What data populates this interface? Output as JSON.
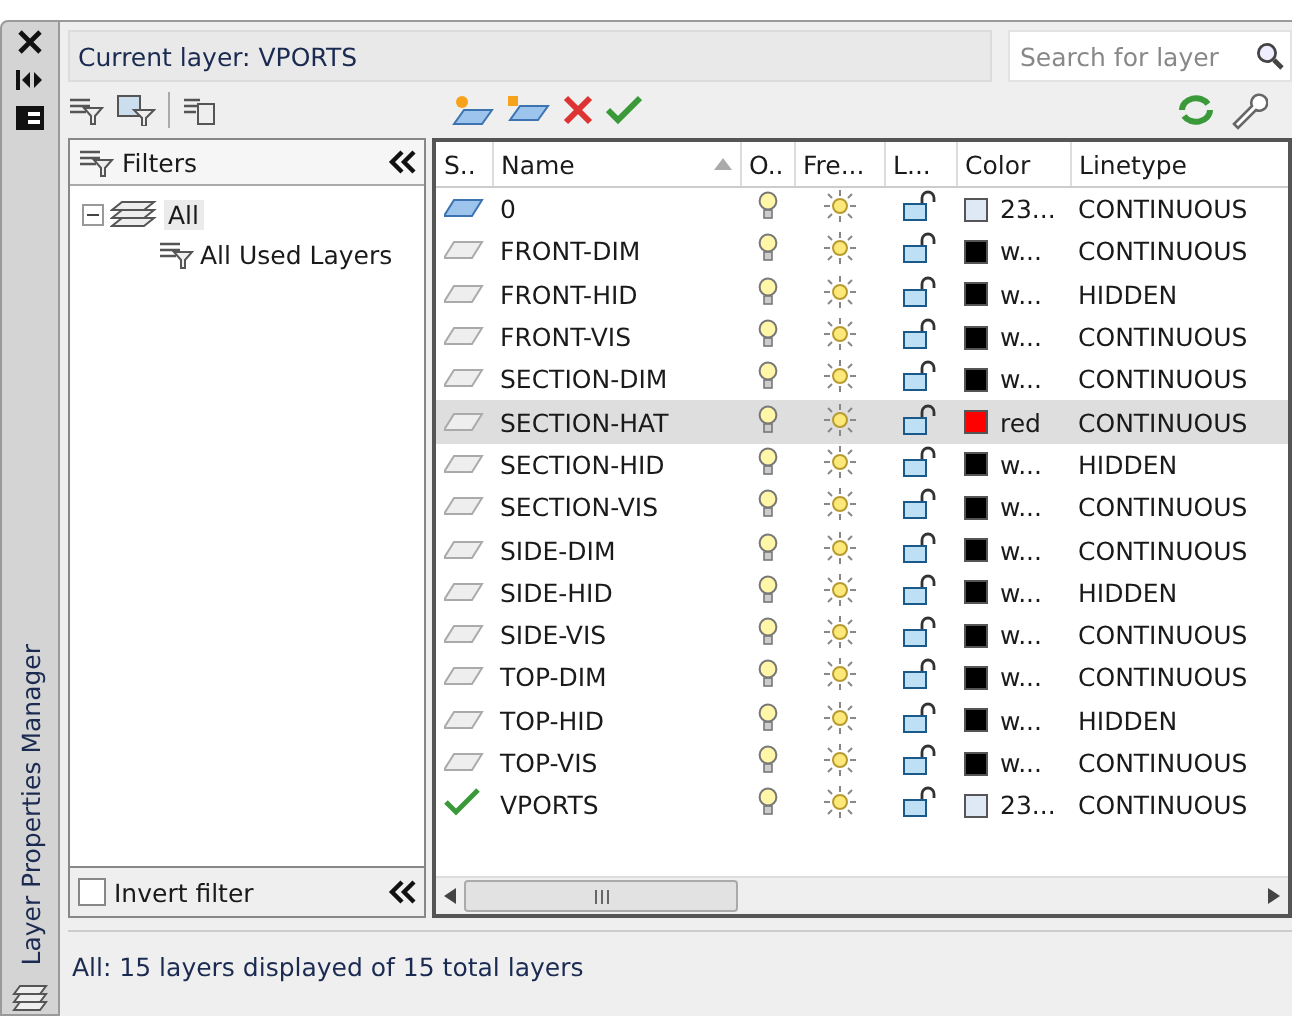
{
  "palette": {
    "title": "Layer Properties Manager"
  },
  "current_layer": "Current layer: VPORTS",
  "search": {
    "placeholder": "Search for layer"
  },
  "filters": {
    "title": "Filters",
    "tree": [
      {
        "label": "All",
        "expanded": true,
        "children": [
          {
            "label": "All Used Layers"
          }
        ]
      }
    ],
    "invert_filter": {
      "label": "Invert filter",
      "checked": false
    }
  },
  "table": {
    "columns": [
      "S..",
      "Name",
      "O..",
      "Fre...",
      "L...",
      "Color",
      "Linetype"
    ],
    "rows": [
      {
        "kind": "used",
        "name": "0",
        "on": true,
        "frozen": false,
        "locked": false,
        "color": "#dfe8f5",
        "color_name": "23...",
        "linetype": "CONTINUOUS",
        "selected": false
      },
      {
        "kind": "unused",
        "name": "FRONT-DIM",
        "on": true,
        "frozen": false,
        "locked": false,
        "color": "#000000",
        "color_name": "w...",
        "linetype": "CONTINUOUS",
        "selected": false
      },
      {
        "kind": "unused",
        "name": "FRONT-HID",
        "on": true,
        "frozen": false,
        "locked": false,
        "color": "#000000",
        "color_name": "w...",
        "linetype": "HIDDEN",
        "selected": false
      },
      {
        "kind": "unused",
        "name": "FRONT-VIS",
        "on": true,
        "frozen": false,
        "locked": false,
        "color": "#000000",
        "color_name": "w...",
        "linetype": "CONTINUOUS",
        "selected": false
      },
      {
        "kind": "unused",
        "name": "SECTION-DIM",
        "on": true,
        "frozen": false,
        "locked": false,
        "color": "#000000",
        "color_name": "w...",
        "linetype": "CONTINUOUS",
        "selected": false
      },
      {
        "kind": "unused",
        "name": "SECTION-HAT",
        "on": true,
        "frozen": false,
        "locked": false,
        "color": "#ff0000",
        "color_name": "red",
        "linetype": "CONTINUOUS",
        "selected": true
      },
      {
        "kind": "unused",
        "name": "SECTION-HID",
        "on": true,
        "frozen": false,
        "locked": false,
        "color": "#000000",
        "color_name": "w...",
        "linetype": "HIDDEN",
        "selected": false
      },
      {
        "kind": "unused",
        "name": "SECTION-VIS",
        "on": true,
        "frozen": false,
        "locked": false,
        "color": "#000000",
        "color_name": "w...",
        "linetype": "CONTINUOUS",
        "selected": false
      },
      {
        "kind": "unused",
        "name": "SIDE-DIM",
        "on": true,
        "frozen": false,
        "locked": false,
        "color": "#000000",
        "color_name": "w...",
        "linetype": "CONTINUOUS",
        "selected": false
      },
      {
        "kind": "unused",
        "name": "SIDE-HID",
        "on": true,
        "frozen": false,
        "locked": false,
        "color": "#000000",
        "color_name": "w...",
        "linetype": "HIDDEN",
        "selected": false
      },
      {
        "kind": "unused",
        "name": "SIDE-VIS",
        "on": true,
        "frozen": false,
        "locked": false,
        "color": "#000000",
        "color_name": "w...",
        "linetype": "CONTINUOUS",
        "selected": false
      },
      {
        "kind": "unused",
        "name": "TOP-DIM",
        "on": true,
        "frozen": false,
        "locked": false,
        "color": "#000000",
        "color_name": "w...",
        "linetype": "CONTINUOUS",
        "selected": false
      },
      {
        "kind": "unused",
        "name": "TOP-HID",
        "on": true,
        "frozen": false,
        "locked": false,
        "color": "#000000",
        "color_name": "w...",
        "linetype": "HIDDEN",
        "selected": false
      },
      {
        "kind": "unused",
        "name": "TOP-VIS",
        "on": true,
        "frozen": false,
        "locked": false,
        "color": "#000000",
        "color_name": "w...",
        "linetype": "CONTINUOUS",
        "selected": false
      },
      {
        "kind": "current",
        "name": "VPORTS",
        "on": true,
        "frozen": false,
        "locked": false,
        "color": "#dfe8f5",
        "color_name": "23...",
        "linetype": "CONTINUOUS",
        "selected": false
      }
    ]
  },
  "status_bar": "All: 15 layers displayed of 15 total layers"
}
